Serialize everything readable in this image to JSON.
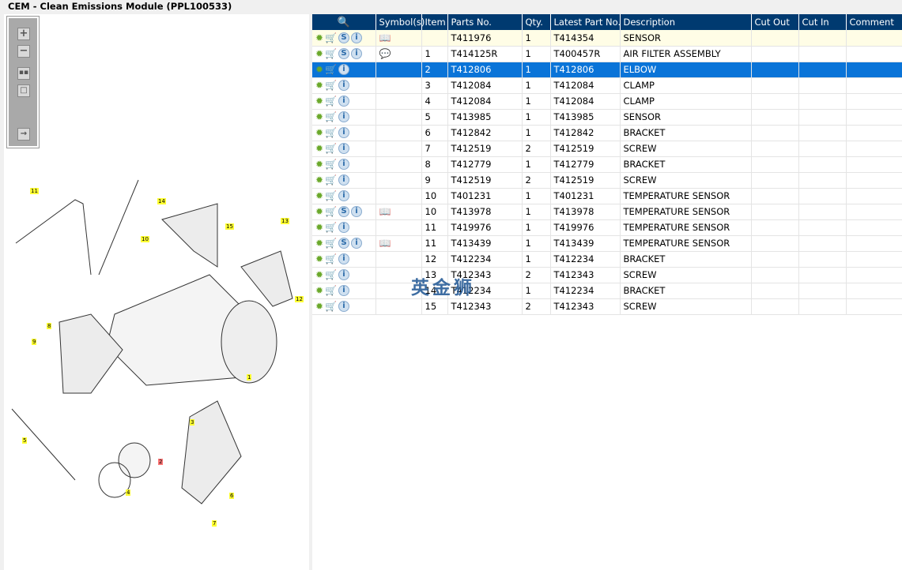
{
  "title": "CEM - Clean Emissions Module (PPL100533)",
  "toolbar": {
    "zoom_in": "zoom-in",
    "zoom_out": "zoom-out",
    "fit": "fit-all",
    "actual": "actual-size",
    "export": "export"
  },
  "diagram": {
    "callouts": [
      "11",
      "10",
      "14",
      "15",
      "13",
      "12",
      "8",
      "9",
      "1",
      "3",
      "5",
      "2",
      "4",
      "6",
      "7"
    ],
    "highlighted_callout": "2"
  },
  "table": {
    "columns": [
      "",
      "Symbol(s)",
      "Item",
      "Parts No.",
      "Qty.",
      "Latest Part No.",
      "Description",
      "Cut Out",
      "Cut In",
      "Comment"
    ],
    "rows": [
      {
        "s": true,
        "sym": "book",
        "item": "",
        "part": "T411976",
        "qty": "1",
        "latest": "T414354",
        "desc": "SENSOR"
      },
      {
        "s": true,
        "sym": "note",
        "item": "1",
        "part": "T414125R",
        "qty": "1",
        "latest": "T400457R",
        "desc": "AIR FILTER ASSEMBLY"
      },
      {
        "s": false,
        "sym": "",
        "item": "2",
        "part": "T412806",
        "qty": "1",
        "latest": "T412806",
        "desc": "ELBOW",
        "selected": true
      },
      {
        "s": false,
        "sym": "",
        "item": "3",
        "part": "T412084",
        "qty": "1",
        "latest": "T412084",
        "desc": "CLAMP"
      },
      {
        "s": false,
        "sym": "",
        "item": "4",
        "part": "T412084",
        "qty": "1",
        "latest": "T412084",
        "desc": "CLAMP"
      },
      {
        "s": false,
        "sym": "",
        "item": "5",
        "part": "T413985",
        "qty": "1",
        "latest": "T413985",
        "desc": "SENSOR"
      },
      {
        "s": false,
        "sym": "",
        "item": "6",
        "part": "T412842",
        "qty": "1",
        "latest": "T412842",
        "desc": "BRACKET"
      },
      {
        "s": false,
        "sym": "",
        "item": "7",
        "part": "T412519",
        "qty": "2",
        "latest": "T412519",
        "desc": "SCREW"
      },
      {
        "s": false,
        "sym": "",
        "item": "8",
        "part": "T412779",
        "qty": "1",
        "latest": "T412779",
        "desc": "BRACKET"
      },
      {
        "s": false,
        "sym": "",
        "item": "9",
        "part": "T412519",
        "qty": "2",
        "latest": "T412519",
        "desc": "SCREW"
      },
      {
        "s": false,
        "sym": "",
        "item": "10",
        "part": "T401231",
        "qty": "1",
        "latest": "T401231",
        "desc": "TEMPERATURE SENSOR"
      },
      {
        "s": true,
        "sym": "book",
        "item": "10",
        "part": "T413978",
        "qty": "1",
        "latest": "T413978",
        "desc": "TEMPERATURE SENSOR"
      },
      {
        "s": false,
        "sym": "",
        "item": "11",
        "part": "T419976",
        "qty": "1",
        "latest": "T419976",
        "desc": "TEMPERATURE SENSOR"
      },
      {
        "s": true,
        "sym": "book",
        "item": "11",
        "part": "T413439",
        "qty": "1",
        "latest": "T413439",
        "desc": "TEMPERATURE SENSOR"
      },
      {
        "s": false,
        "sym": "",
        "item": "12",
        "part": "T412234",
        "qty": "1",
        "latest": "T412234",
        "desc": "BRACKET"
      },
      {
        "s": false,
        "sym": "",
        "item": "13",
        "part": "T412343",
        "qty": "2",
        "latest": "T412343",
        "desc": "SCREW"
      },
      {
        "s": false,
        "sym": "",
        "item": "14",
        "part": "T412234",
        "qty": "1",
        "latest": "T412234",
        "desc": "BRACKET"
      },
      {
        "s": false,
        "sym": "",
        "item": "15",
        "part": "T412343",
        "qty": "2",
        "latest": "T412343",
        "desc": "SCREW"
      }
    ]
  },
  "watermark": "英金狮"
}
